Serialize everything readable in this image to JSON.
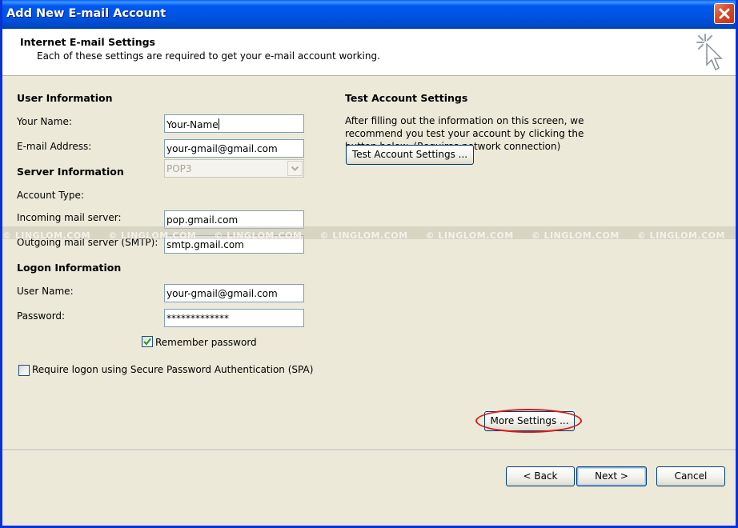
{
  "window": {
    "title": "Add New E-mail Account"
  },
  "header": {
    "title": "Internet E-mail Settings",
    "subtitle": "Each of these settings are required to get your e-mail account working."
  },
  "user_info": {
    "heading": "User Information",
    "name_label": "Your Name:",
    "name_value": "Your-Name",
    "email_label": "E-mail Address:",
    "email_value": "your-gmail@gmail.com"
  },
  "server_info": {
    "heading": "Server Information",
    "account_type_label": "Account Type:",
    "account_type_value": "POP3",
    "incoming_label": "Incoming mail server:",
    "incoming_value": "pop.gmail.com",
    "outgoing_label": "Outgoing mail server (SMTP):",
    "outgoing_value": "smtp.gmail.com"
  },
  "logon_info": {
    "heading": "Logon Information",
    "username_label": "User Name:",
    "username_value": "your-gmail@gmail.com",
    "password_label": "Password:",
    "password_value": "*************",
    "remember_label": "Remember password",
    "remember_checked": true,
    "spa_label": "Require logon using Secure Password Authentication (SPA)",
    "spa_checked": false
  },
  "test": {
    "heading": "Test Account Settings",
    "description": "After filling out the information on this screen, we recommend you test your account by clicking the button below. (Requires network connection)",
    "button_label": "Test Account Settings ..."
  },
  "watermark": {
    "text": "© LINGLOM.COM"
  },
  "buttons": {
    "more_settings": "More Settings ...",
    "back": "< Back",
    "next": "Next >",
    "cancel": "Cancel"
  },
  "icons": {
    "close": "close-icon",
    "setup": "cursor-sparkle-icon",
    "dropdown": "chevron-down-icon",
    "check": "checkmark-icon"
  },
  "colors": {
    "titlebar": "#0054e3",
    "close": "#d6492a",
    "highlight_oval": "#d81818",
    "dialog_bg": "#ece9d8"
  }
}
